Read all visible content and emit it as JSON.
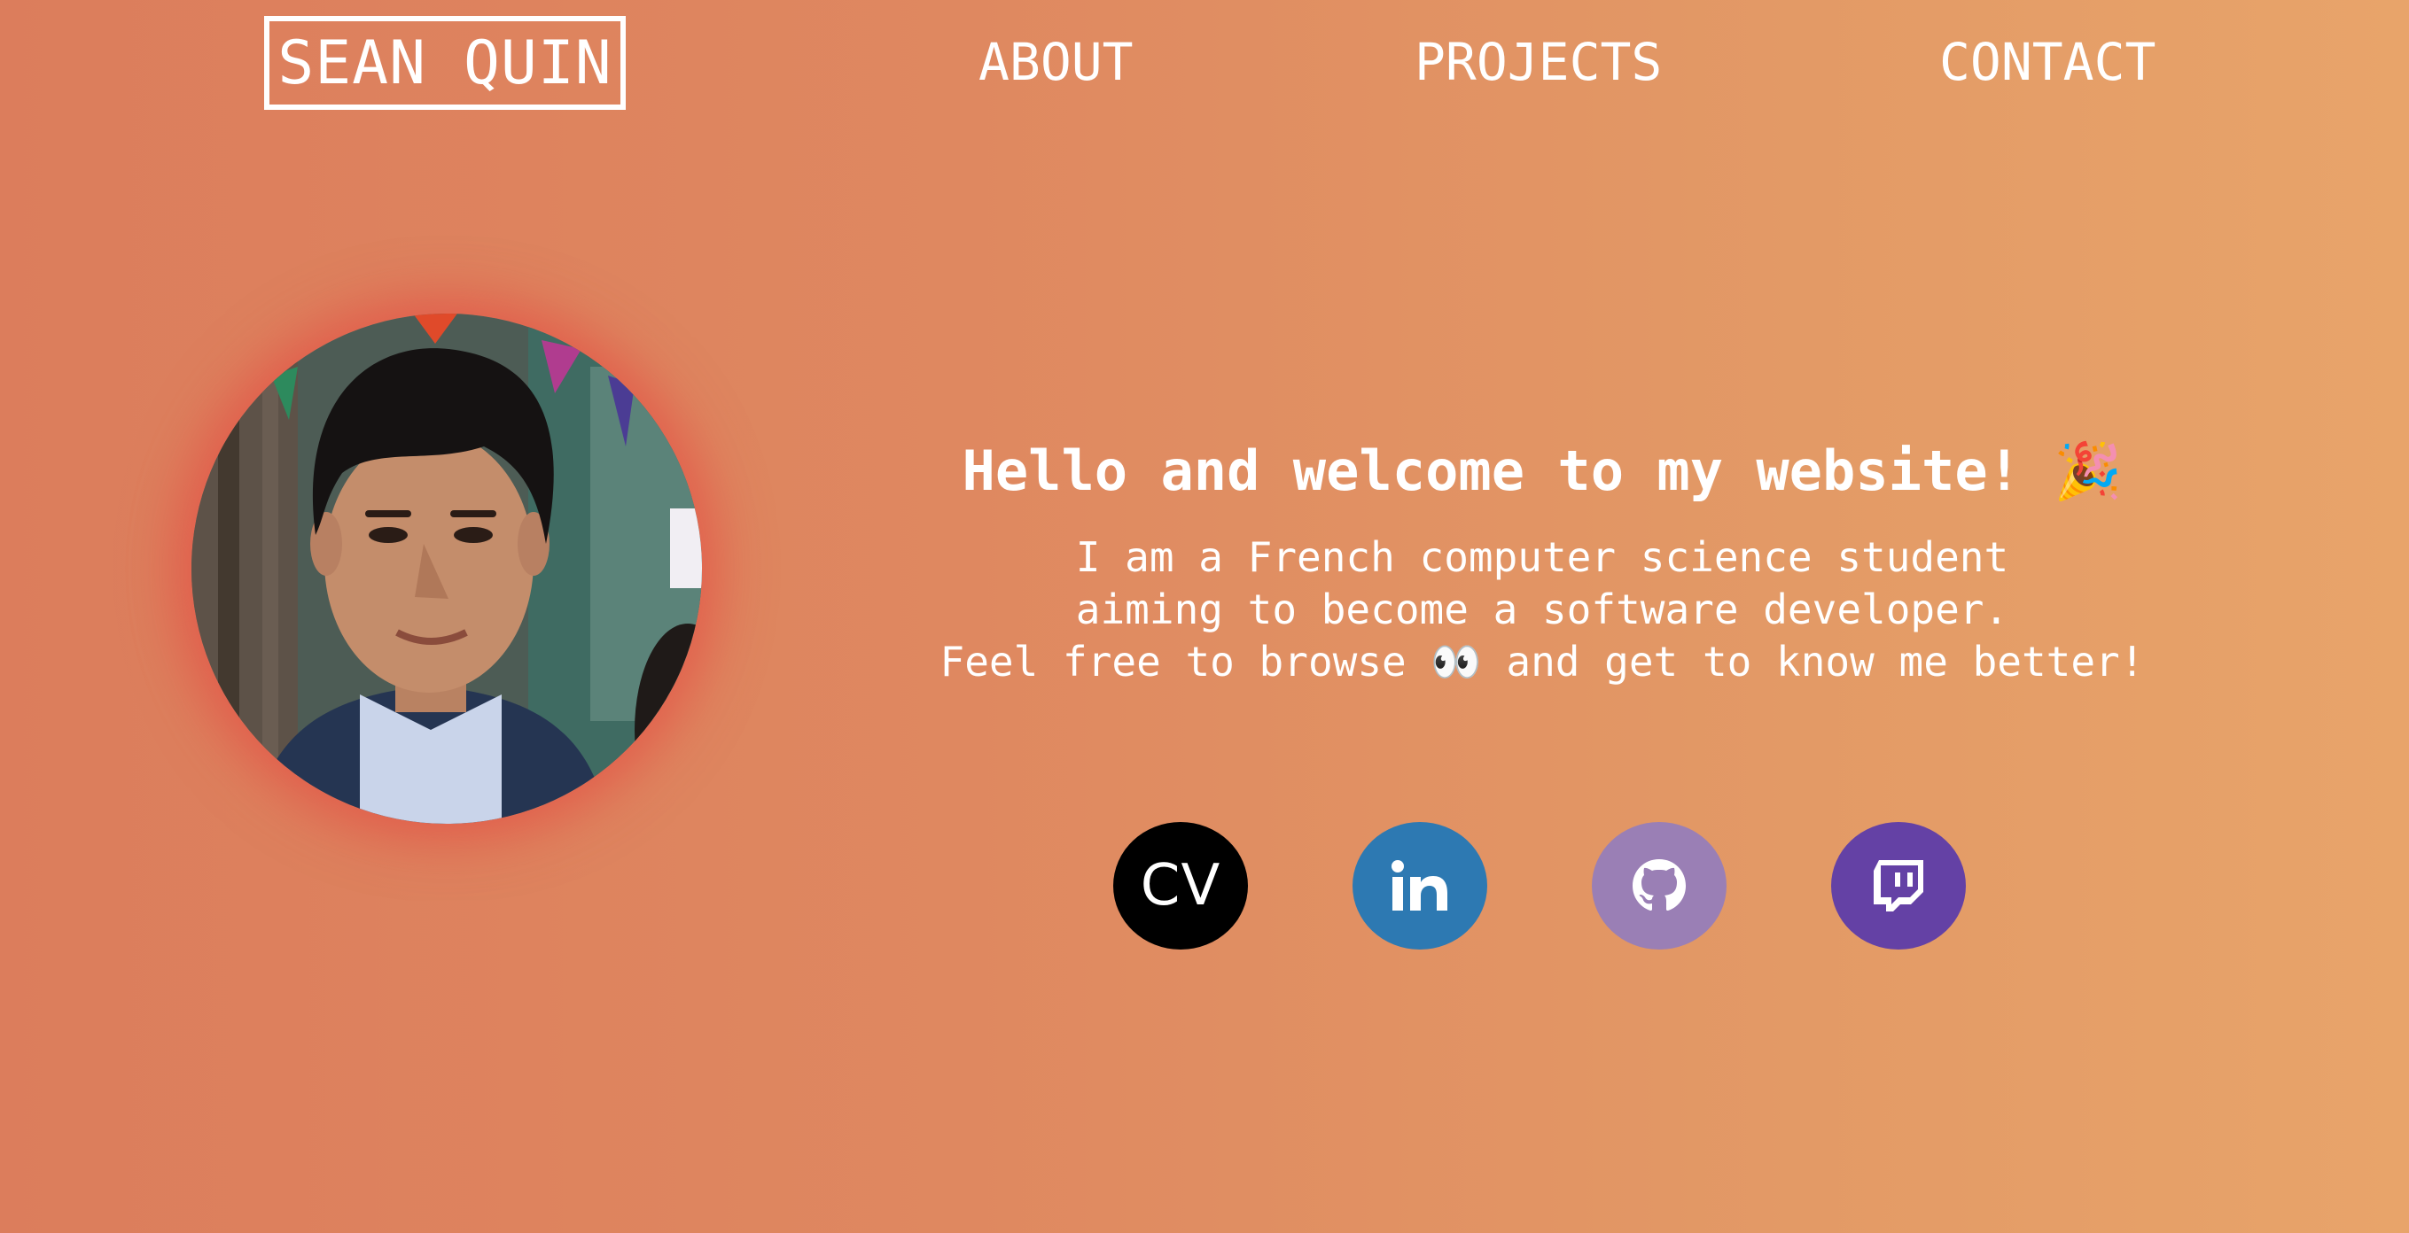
{
  "header": {
    "logo_text": "SEAN QUIN",
    "nav": [
      {
        "label": "ABOUT"
      },
      {
        "label": "PROJECTS"
      },
      {
        "label": "CONTACT"
      }
    ]
  },
  "hero": {
    "title": "Hello and welcome to my website! 🎉",
    "lines": [
      "I am a French computer science student",
      "aiming to become a software developer.",
      "Feel free to browse 👀 and get to know me better!"
    ]
  },
  "social": {
    "cv_label": "CV",
    "links": [
      {
        "icon": "cv-icon",
        "color": "#000000"
      },
      {
        "icon": "linkedin-icon",
        "color": "#2d79b2"
      },
      {
        "icon": "github-icon",
        "color": "#9a7fb5"
      },
      {
        "icon": "twitch-icon",
        "color": "#6441a5"
      }
    ]
  },
  "colors": {
    "background_start": "#dc7d5c",
    "background_end": "#e8a46a",
    "avatar_glow": "#e53e3c",
    "text": "#ffffff"
  }
}
